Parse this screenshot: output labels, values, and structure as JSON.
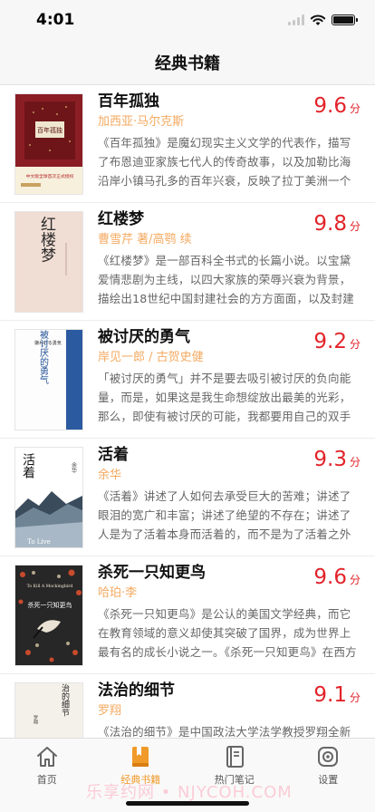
{
  "status": {
    "time": "4:01"
  },
  "nav": {
    "title": "经典书籍"
  },
  "books": [
    {
      "title": "百年孤独",
      "author": "加西亚·马尔克斯",
      "score": "9.6",
      "unit": "分",
      "desc": "《百年孤独》是魔幻现实主义文学的代表作，描写了布恩迪亚家族七代人的传奇故事，以及加勒比海沿岸小镇马孔多的百年兴衰，反映了拉丁美洲一个世纪以来风云变幻的历史。",
      "cover": {
        "text": "百年孤独",
        "band": "中文版全球首次正式授权"
      }
    },
    {
      "title": "红楼梦",
      "author": "曹雪芹 著/高鹗 续",
      "score": "9.8",
      "unit": "分",
      "desc": "《红楼梦》是一部百科全书式的长篇小说。以宝黛爱情悲剧为主线，以四大家族的荣辱兴衰为背景，描绘出18世纪中国封建社会的方方面面，以及封建专制下新兴资本主义民主思想的萌动。",
      "cover": {
        "text": "红楼梦"
      }
    },
    {
      "title": "被讨厌的勇气",
      "author": "岸见一郎 / 古贺史健",
      "score": "9.2",
      "unit": "分",
      "desc": "「被讨厌的勇气」并不是要去吸引被讨厌的负向能量，而是，如果这是我生命想绽放出最美的光彩，那么，即使有被讨厌的可能，我都要用自己的双手和力量去争取。",
      "cover": {
        "text": "被讨厌的勇气",
        "sub": "嫌われる勇気"
      }
    },
    {
      "title": "活着",
      "author": "余华",
      "score": "9.3",
      "unit": "分",
      "desc": "《活着》讲述了人如何去承受巨大的苦难；讲述了眼泪的宽广和丰富；讲述了绝望的不存在；讲述了人是为了活着本身而活着的，而不是为了活着之外的任何事物而活着。",
      "cover": {
        "text": "活着",
        "author": "余华",
        "en": "To Live"
      }
    },
    {
      "title": "杀死一只知更鸟",
      "author": "哈珀·李",
      "score": "9.6",
      "unit": "分",
      "desc": "《杀死一只知更鸟》是公认的美国文学经典，而它在教育领域的意义却使其突破了国界，成为世界上最有名的成长小说之一。《杀死一只知更鸟》在西方是一本常青的畅销书。",
      "cover": {
        "text": "杀死一只知更鸟",
        "en": "To Kill A Mockingbird"
      }
    },
    {
      "title": "法治的细节",
      "author": "罗翔",
      "score": "9.1",
      "unit": "分",
      "desc": "《法治的细节》是中国政法大学法学教授罗翔全新作品，由近年来引发关注的热点案件与法治事件入手，讲述法治的细节。",
      "cover": {
        "text": "法治的细节",
        "author": "罗翔"
      }
    }
  ],
  "tabs": [
    {
      "label": "首页",
      "icon": "home-icon"
    },
    {
      "label": "经典书籍",
      "icon": "book-icon",
      "active": true
    },
    {
      "label": "热门笔记",
      "icon": "notes-icon"
    },
    {
      "label": "设置",
      "icon": "settings-icon"
    }
  ],
  "watermark": "乐享约网 • NJYCOH.COM",
  "colors": {
    "accent": "#f09a2a",
    "score": "#e2232a",
    "author": "#f4a960"
  }
}
